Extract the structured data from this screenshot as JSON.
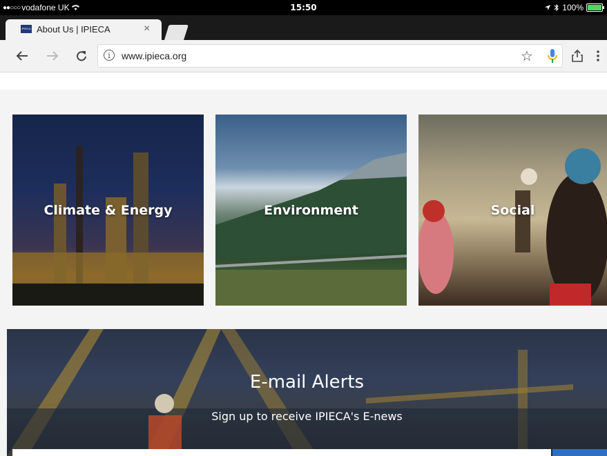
{
  "status_bar": {
    "signal": "●●○○○",
    "carrier": "vodafone UK",
    "time": "15:50",
    "battery": "100%"
  },
  "tab": {
    "title": "About Us | IPIECA",
    "close": "×"
  },
  "toolbar": {
    "url": "www.ipieca.org"
  },
  "cards": [
    {
      "label": "Climate & Energy"
    },
    {
      "label": "Environment"
    },
    {
      "label": "Social"
    }
  ],
  "email": {
    "title": "E-mail Alerts",
    "subtitle": "Sign up to receive IPIECA's E-news"
  },
  "colors": {
    "accent": "#2d6fc2",
    "battery": "#4cd964"
  }
}
